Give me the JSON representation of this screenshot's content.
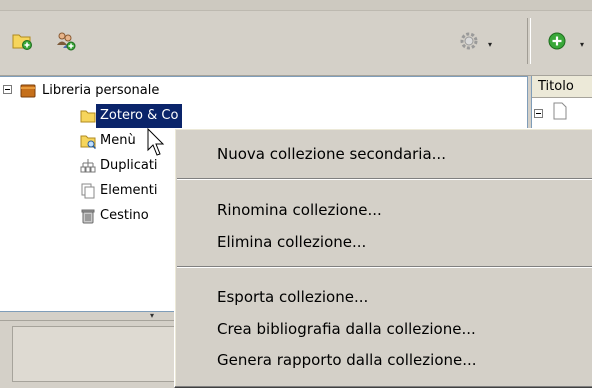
{
  "toolbar": {
    "buttons": [
      {
        "icon": "new-collection-icon"
      },
      {
        "icon": "new-group-icon"
      },
      {
        "icon": "gear-icon"
      },
      {
        "icon": "add-item-icon"
      }
    ],
    "dropdown_glyph": "▾"
  },
  "tree": {
    "library_label": "Libreria personale",
    "items": [
      {
        "label": "Zotero & Co",
        "icon": "folder-icon"
      },
      {
        "label": "Menù",
        "icon": "saved-search-icon"
      },
      {
        "label": "Duplicati",
        "icon": "duplicates-icon"
      },
      {
        "label": "Elementi",
        "icon": "unfiled-items-icon"
      },
      {
        "label": "Cestino",
        "icon": "trash-icon"
      }
    ],
    "grippy": "▾"
  },
  "items_pane": {
    "column_header": "Titolo"
  },
  "context_menu": {
    "items": [
      "Nuova collezione secondaria...",
      "Rinomina collezione...",
      "Elimina collezione...",
      "Esporta collezione...",
      "Crea bibliografia dalla collezione...",
      "Genera rapporto dalla collezione..."
    ]
  },
  "colors": {
    "selection": "#0a246a",
    "window_bg": "#d4d0c8",
    "pane_border": "#7f9db9"
  }
}
